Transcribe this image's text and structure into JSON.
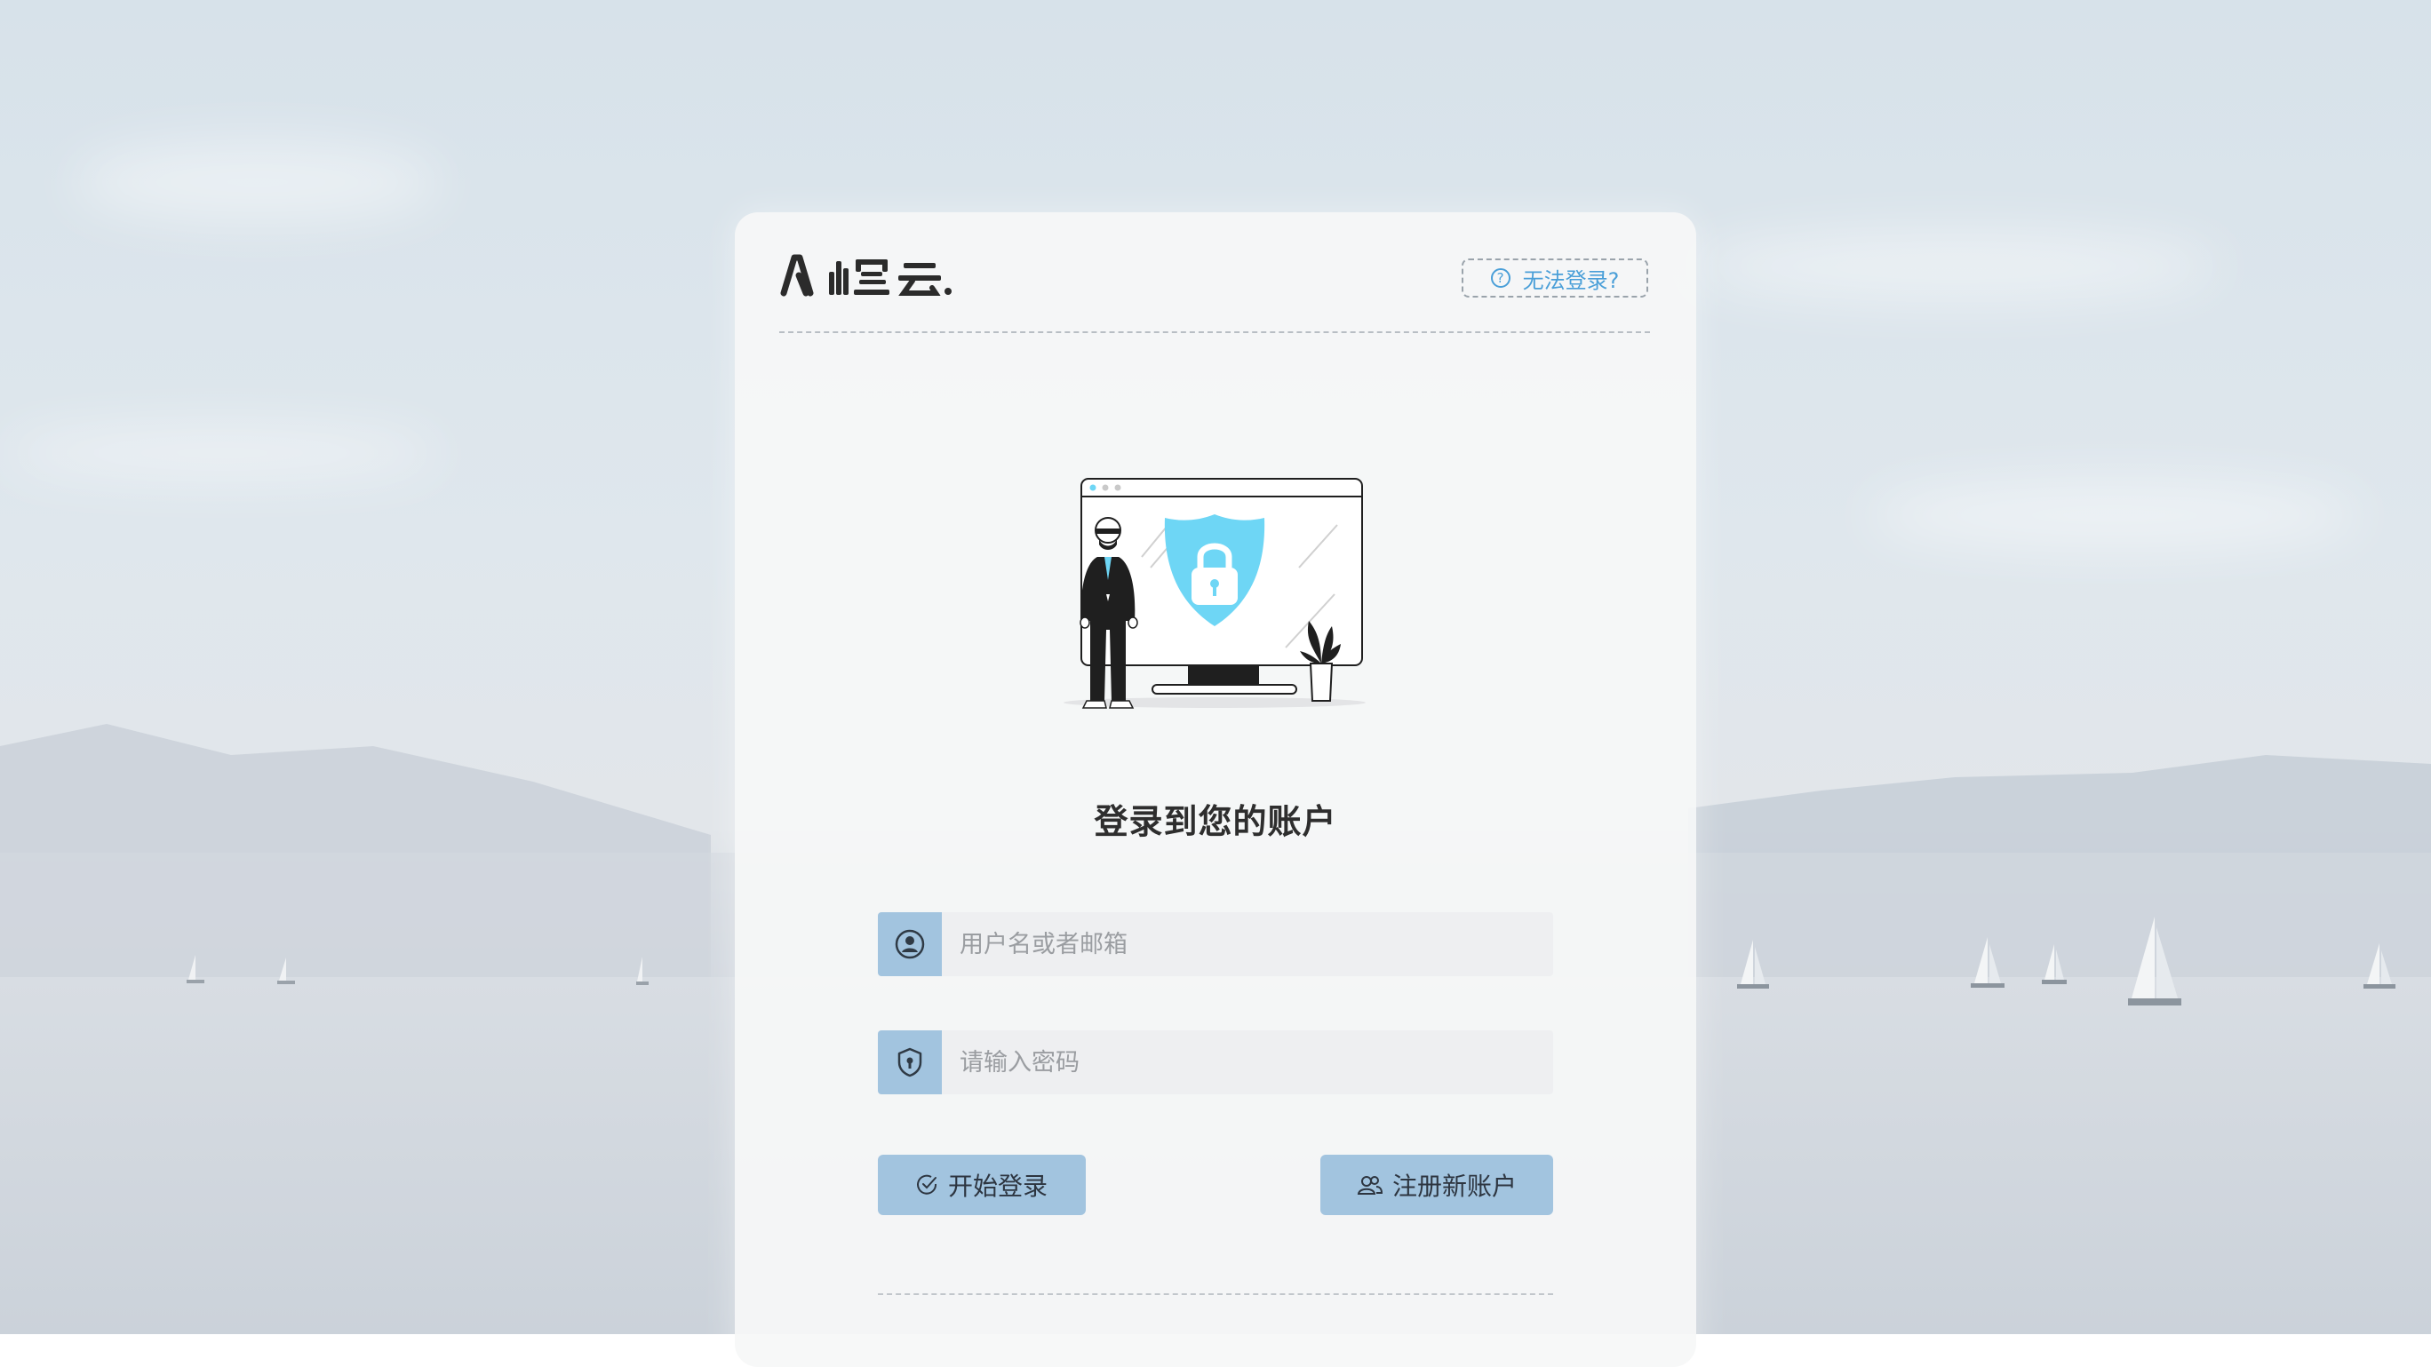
{
  "header": {
    "help_label": "无法登录?"
  },
  "login": {
    "title": "登录到您的账户",
    "username_placeholder": "用户名或者邮箱",
    "password_placeholder": "请输入密码",
    "login_label": "开始登录",
    "register_label": "注册新账户"
  },
  "icons": {
    "help": "question-circle-icon",
    "user": "user-circle-icon",
    "password": "shield-keyhole-icon",
    "login": "check-circle-icon",
    "register": "users-icon"
  },
  "colors": {
    "accent": "#a2c4df",
    "link": "#4a9fd8",
    "shield": "#6ed6f5"
  }
}
